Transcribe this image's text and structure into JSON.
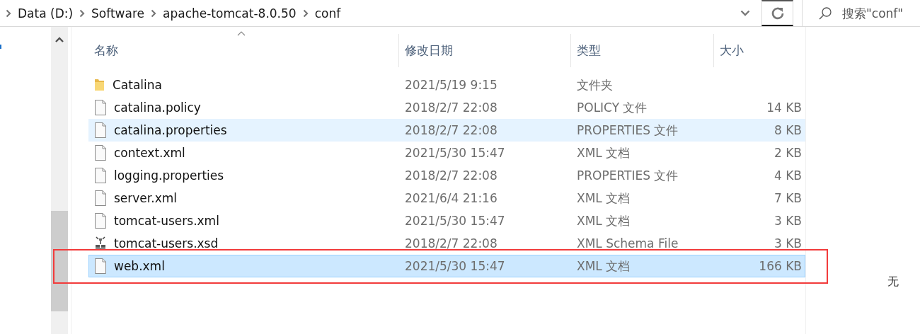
{
  "address_bar": {
    "path": [
      "Data (D:)",
      "Software",
      "apache-tomcat-8.0.50",
      "conf"
    ]
  },
  "search": {
    "placeholder": "搜索\"conf\""
  },
  "columns": [
    {
      "label": "名称",
      "sorted": true
    },
    {
      "label": "修改日期",
      "sorted": false
    },
    {
      "label": "类型",
      "sorted": false
    },
    {
      "label": "大小",
      "sorted": false
    }
  ],
  "files": [
    {
      "kind": "folder",
      "name": "Catalina",
      "modified": "2021/5/19 9:15",
      "type": "文件夹",
      "selected": false,
      "hovered": false
    },
    {
      "kind": "file",
      "name": "catalina.policy",
      "modified": "2018/2/7 22:08",
      "type": "POLICY 文件",
      "size": "14 KB",
      "selected": false,
      "hovered": false
    },
    {
      "kind": "file",
      "name": "catalina.properties",
      "modified": "2018/2/7 22:08",
      "type": "PROPERTIES 文件",
      "size": "8 KB",
      "selected": false,
      "hovered": true
    },
    {
      "kind": "file",
      "name": "context.xml",
      "modified": "2021/5/30 15:47",
      "type": "XML 文档",
      "size": "2 KB",
      "selected": false,
      "hovered": false
    },
    {
      "kind": "file",
      "name": "logging.properties",
      "modified": "2018/2/7 22:08",
      "type": "PROPERTIES 文件",
      "size": "4 KB",
      "selected": false,
      "hovered": false
    },
    {
      "kind": "file",
      "name": "server.xml",
      "modified": "2021/6/4 21:16",
      "type": "XML 文档",
      "size": "7 KB",
      "selected": false,
      "hovered": false
    },
    {
      "kind": "file",
      "name": "tomcat-users.xml",
      "modified": "2021/5/30 15:47",
      "type": "XML 文档",
      "size": "3 KB",
      "selected": false,
      "hovered": false
    },
    {
      "kind": "schema",
      "name": "tomcat-users.xsd",
      "modified": "2018/2/7 22:08",
      "type": "XML Schema File",
      "size": "3 KB",
      "selected": false,
      "hovered": false
    },
    {
      "kind": "file",
      "name": "web.xml",
      "modified": "2021/5/30 15:47",
      "type": "XML 文档",
      "size": "166 KB",
      "selected": true,
      "hovered": false
    }
  ],
  "side_text": "无"
}
